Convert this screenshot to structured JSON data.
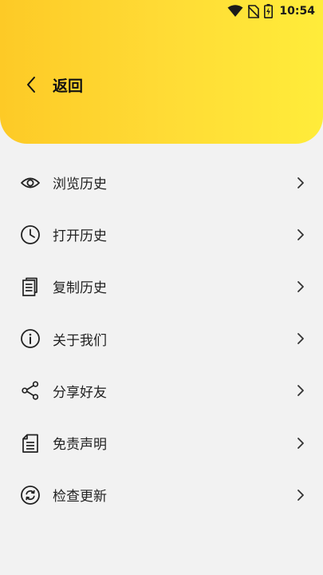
{
  "status_bar": {
    "time": "10:54",
    "icons": [
      "wifi-icon",
      "no-sim-icon",
      "battery-charging-icon"
    ]
  },
  "header": {
    "back_label": "返回",
    "gradient_colors": [
      "#fdca26",
      "#ffec3a"
    ]
  },
  "menu": {
    "items": [
      {
        "label": "浏览历史",
        "icon": "eye-icon"
      },
      {
        "label": "打开历史",
        "icon": "clock-icon"
      },
      {
        "label": "复制历史",
        "icon": "copy-document-icon"
      },
      {
        "label": "关于我们",
        "icon": "info-icon"
      },
      {
        "label": "分享好友",
        "icon": "share-icon"
      },
      {
        "label": "免责声明",
        "icon": "disclaimer-document-icon"
      },
      {
        "label": "检查更新",
        "icon": "refresh-icon"
      }
    ]
  },
  "colors": {
    "background": "#f2f2f2",
    "text": "#222222"
  }
}
